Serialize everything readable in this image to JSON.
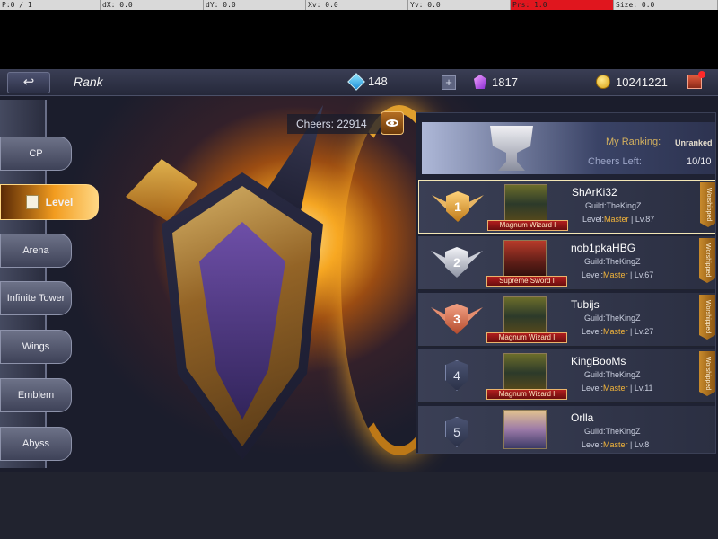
{
  "debug_bar": [
    "P:0 / 1",
    "dX: 0.0",
    "dY: 0.0",
    "Xv: 0.0",
    "Yv: 0.0",
    "Prs: 1.0",
    "Size: 0.0"
  ],
  "header": {
    "back_glyph": "↩",
    "title": "Rank"
  },
  "resources": {
    "diamonds": "148",
    "crystals": "1817",
    "gold": "10241221",
    "add_glyph": "+"
  },
  "sidebar": {
    "items": [
      {
        "label": "CP"
      },
      {
        "label": "Level"
      },
      {
        "label": "Arena"
      },
      {
        "label": "Infinite Tower"
      },
      {
        "label": "Wings"
      },
      {
        "label": "Emblem"
      },
      {
        "label": "Abyss"
      }
    ],
    "active_index": 1
  },
  "cheers": {
    "label": "Cheers: 22914"
  },
  "my_ranking": {
    "label": "My Ranking:",
    "value": "Unranked",
    "cheers_left_label": "Cheers Left:",
    "cheers_left_value": "10/10"
  },
  "players": [
    {
      "rank": "1",
      "name": "ShArKi32",
      "guild": "Guild:TheKingZ",
      "level_prefix": "Level:",
      "level_tier": "Master",
      "level_num": " | Lv.87",
      "class": "Magnum Wizard I",
      "worship": "Worshipped"
    },
    {
      "rank": "2",
      "name": "nob1pkaHBG",
      "guild": "Guild:TheKingZ",
      "level_prefix": "Level:",
      "level_tier": "Master",
      "level_num": " | Lv.67",
      "class": "Supreme Sword I",
      "worship": "Worshipped"
    },
    {
      "rank": "3",
      "name": "Tubijs",
      "guild": "Guild:TheKingZ",
      "level_prefix": "Level:",
      "level_tier": "Master",
      "level_num": " | Lv.27",
      "class": "Magnum Wizard I",
      "worship": "Worshipped"
    },
    {
      "rank": "4",
      "name": "KingBooMs",
      "guild": "Guild:TheKingZ",
      "level_prefix": "Level:",
      "level_tier": "Master",
      "level_num": " | Lv.11",
      "class": "Magnum Wizard I",
      "worship": "Worshipped"
    },
    {
      "rank": "5",
      "name": "Orlla",
      "guild": "Guild:TheKingZ",
      "level_prefix": "Level:",
      "level_tier": "Master",
      "level_num": " | Lv.8"
    }
  ],
  "colors": {
    "accent_gold": "#f2b43a",
    "active_tab": "#f29c1f",
    "debug_pressure": "#e0161e"
  }
}
